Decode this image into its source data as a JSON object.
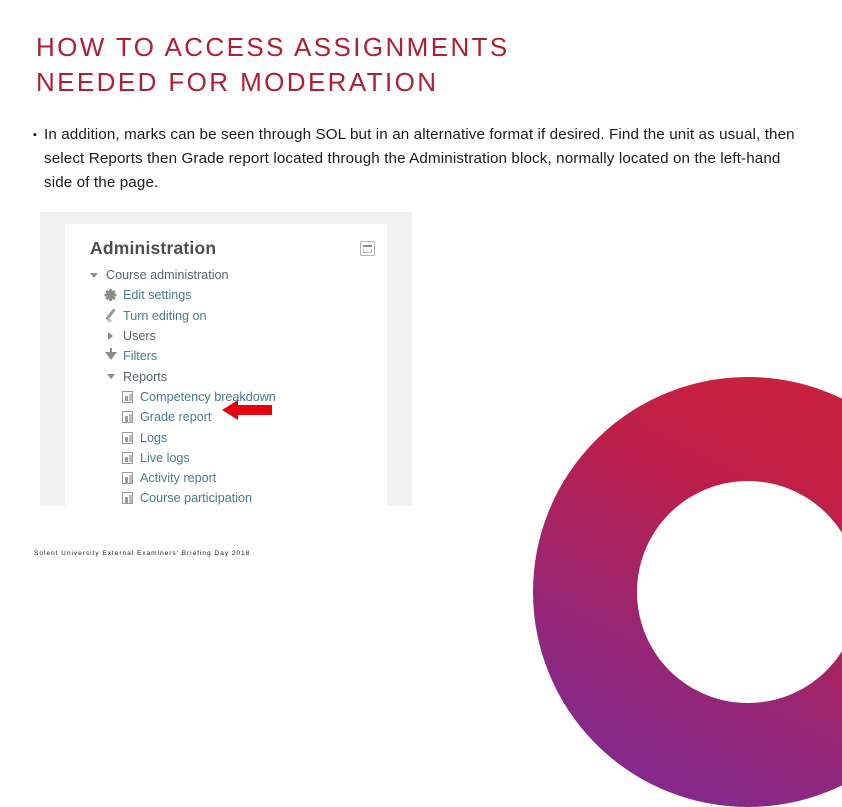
{
  "slide": {
    "title": "HOW TO ACCESS ASSIGNMENTS NEEDED FOR MODERATION",
    "title_line1": "HOW TO ACCESS ASSIGNMENTS",
    "title_line2": "NEEDED FOR MODERATION",
    "title_color": "#AF1F33",
    "bullet_marker": "▪",
    "bullet_text": "In addition, marks can be seen through SOL but in an alternative format if desired. Find the unit as usual, then select Reports then Grade report located through the Administration block, normally located on the left-hand side of the page.",
    "footer": "Solent University External Examiners' Briefing Day 2018"
  },
  "screenshot": {
    "block_title": "Administration",
    "dock_icon": "dock-collapse-icon",
    "tree": [
      {
        "label": "Course administration",
        "icon": "caret-down-icon",
        "level": 0,
        "style": "plain"
      },
      {
        "label": "Edit settings",
        "icon": "gear-icon",
        "level": 1,
        "style": "link"
      },
      {
        "label": "Turn editing on",
        "icon": "pencil-icon",
        "level": 1,
        "style": "link"
      },
      {
        "label": "Users",
        "icon": "caret-right-icon",
        "level": 1,
        "style": "plain"
      },
      {
        "label": "Filters",
        "icon": "funnel-icon",
        "level": 1,
        "style": "link"
      },
      {
        "label": "Reports",
        "icon": "caret-down-icon",
        "level": 1,
        "style": "plain"
      },
      {
        "label": "Competency breakdown",
        "icon": "report-doc-icon",
        "level": 2,
        "style": "link"
      },
      {
        "label": "Grade report",
        "icon": "report-doc-icon",
        "level": 2,
        "style": "link",
        "annotated": true
      },
      {
        "label": "Logs",
        "icon": "report-doc-icon",
        "level": 2,
        "style": "link"
      },
      {
        "label": "Live logs",
        "icon": "report-doc-icon",
        "level": 2,
        "style": "link"
      },
      {
        "label": "Activity report",
        "icon": "report-doc-icon",
        "level": 2,
        "style": "link"
      },
      {
        "label": "Course participation",
        "icon": "report-doc-icon",
        "level": 2,
        "style": "link"
      }
    ],
    "annotation": {
      "name": "red-arrow-pointing-to-grade-report",
      "color": "#E30011",
      "points_to": "Grade report"
    }
  },
  "decoration": {
    "ring_name": "brand-ring-graphic",
    "gradient_top_color": "#C41F45",
    "gradient_bottom_color": "#8A2A8C"
  }
}
